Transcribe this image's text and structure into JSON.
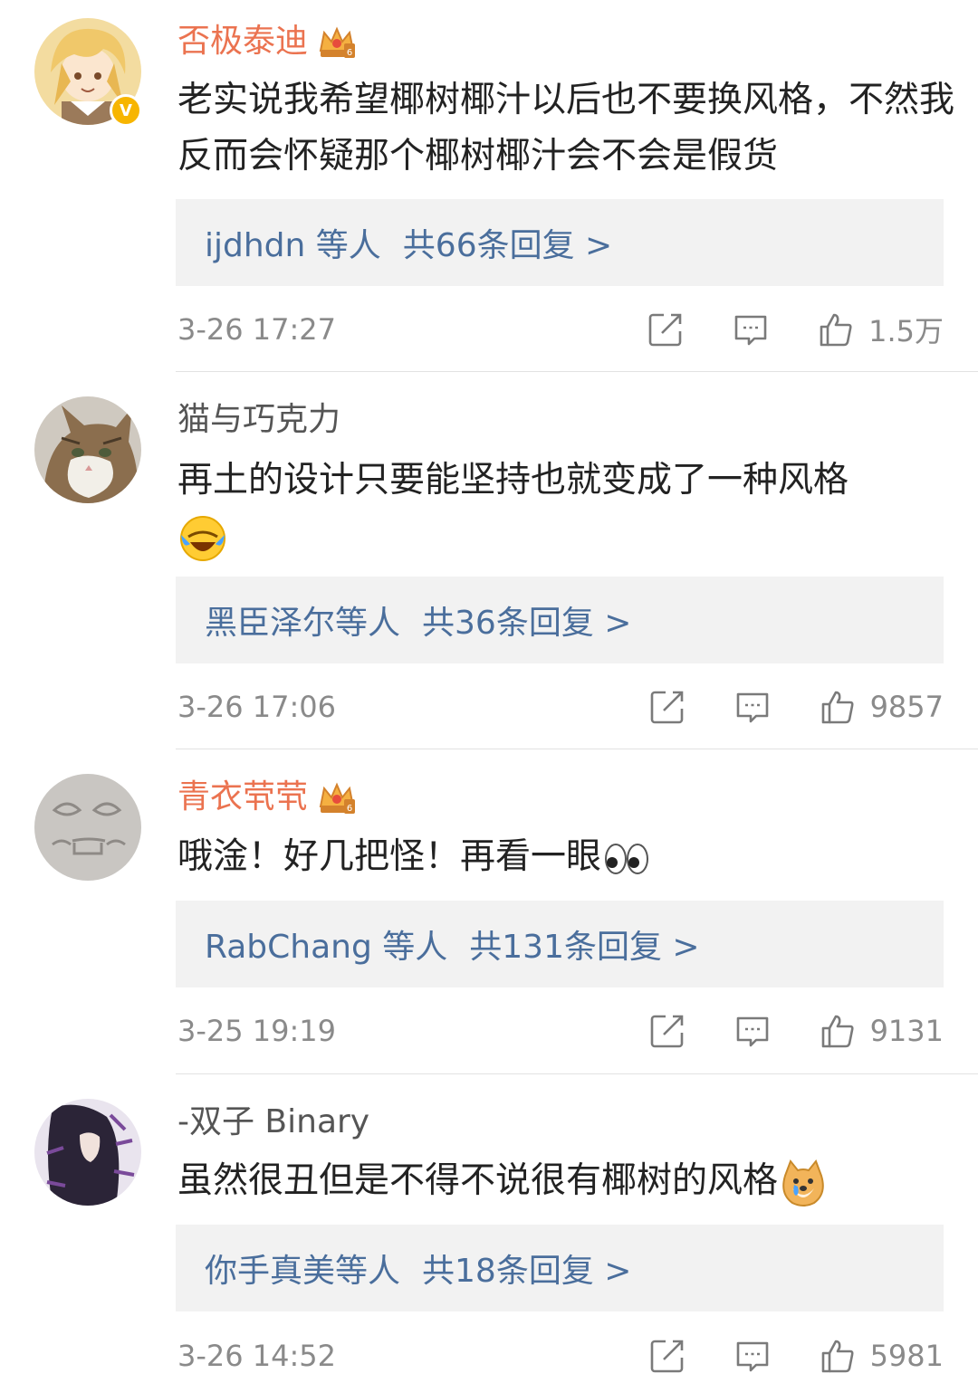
{
  "comments": [
    {
      "username": "否极泰迪",
      "vip": true,
      "verified": true,
      "text": "老实说我希望椰树椰汁以后也不要换风格，不然我反而会怀疑那个椰树椰汁会不会是假货",
      "emoji": null,
      "reply_users": "ijdhdn 等人",
      "reply_count_text": "共66条回复 >",
      "time": "3-26 17:27",
      "likes": "1.5万",
      "avatar_icon": "anime-avatar-icon"
    },
    {
      "username": "猫与巧克力",
      "vip": false,
      "verified": false,
      "text": "再土的设计只要能坚持也就变成了一种风格",
      "emoji": "laugh-cry-emoji",
      "reply_users": "黑臣泽尔等人",
      "reply_count_text": "共36条回复 >",
      "time": "3-26 17:06",
      "likes": "9857",
      "avatar_icon": "cat-avatar-icon"
    },
    {
      "username": "青衣茕茕",
      "vip": true,
      "verified": false,
      "text": "哦淦！好几把怪！再看一眼",
      "emoji": "eyes-emoji",
      "reply_users": "RabChang 等人",
      "reply_count_text": "共131条回复 >",
      "time": "3-25 19:19",
      "likes": "9131",
      "avatar_icon": "sand-face-avatar-icon"
    },
    {
      "username": "-双子 Binary",
      "vip": false,
      "verified": false,
      "text": "虽然很丑但是不得不说很有椰树的风格",
      "emoji": "doge-cry-emoji",
      "reply_users": "你手真美等人",
      "reply_count_text": "共18条回复 >",
      "time": "3-26 14:52",
      "likes": "5981",
      "avatar_icon": "calligraphy-avatar-icon"
    }
  ],
  "icons": {
    "share": "share-icon",
    "comment": "comment-icon",
    "like": "thumbs-up-icon"
  },
  "colors": {
    "vip_name": "#eb7350",
    "link": "#4a6e9c",
    "reply_bg": "#f2f2f2",
    "meta": "#8a8a8a"
  }
}
